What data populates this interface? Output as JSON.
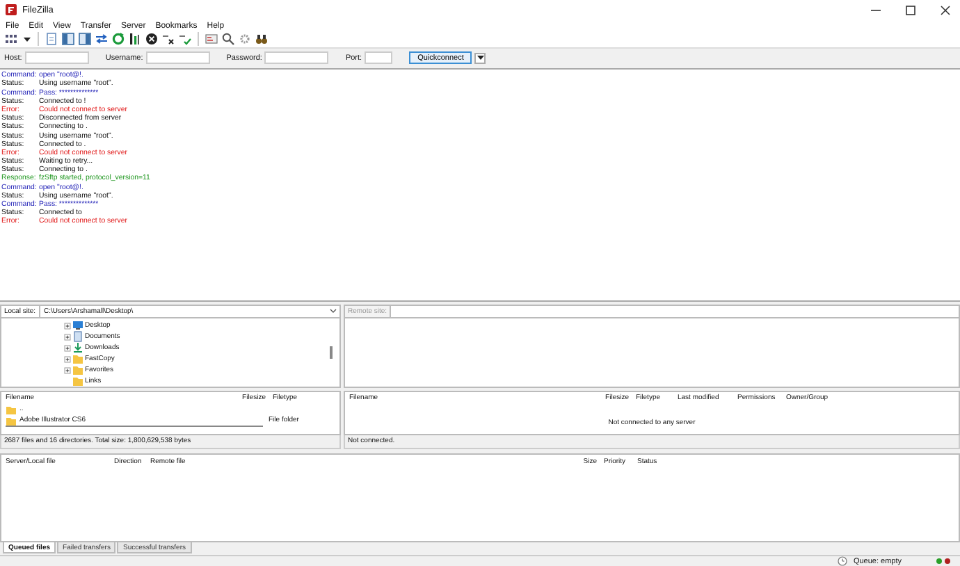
{
  "window": {
    "title": "FileZilla"
  },
  "menu": [
    "File",
    "Edit",
    "View",
    "Transfer",
    "Server",
    "Bookmarks",
    "Help"
  ],
  "quickconnect": {
    "fields": [
      {
        "label": "Host:"
      },
      {
        "label": "Username:"
      },
      {
        "label": "Password:"
      },
      {
        "label": "Port:"
      }
    ],
    "button": "Quickconnect"
  },
  "log": [
    {
      "kind": "command",
      "label": "Command:",
      "message": "open \"root@!."
    },
    {
      "kind": "status",
      "label": "Status:",
      "message": "Using username \"root\"."
    },
    {
      "kind": "command",
      "label": "Command:",
      "message": "Pass: **************"
    },
    {
      "kind": "status",
      "label": "Status:",
      "message": "Connected to !"
    },
    {
      "kind": "error",
      "label": "Error:",
      "message": "Could not connect to server"
    },
    {
      "kind": "status",
      "label": "Status:",
      "message": "Disconnected from server"
    },
    {
      "kind": "status",
      "label": "Status:",
      "message": "Connecting to ."
    },
    {
      "kind": "status",
      "label": "Status:",
      "message": "Using username \"root\"."
    },
    {
      "kind": "status",
      "label": "Status:",
      "message": "Connected to ."
    },
    {
      "kind": "error",
      "label": "Error:",
      "message": "Could not connect to server"
    },
    {
      "kind": "status",
      "label": "Status:",
      "message": "Waiting to retry..."
    },
    {
      "kind": "status",
      "label": "Status:",
      "message": "Connecting to ."
    },
    {
      "kind": "response",
      "label": "Response:",
      "message": "fzSftp started, protocol_version=11"
    },
    {
      "kind": "command",
      "label": "Command:",
      "message": "open \"root@!."
    },
    {
      "kind": "status",
      "label": "Status:",
      "message": "Using username \"root\"."
    },
    {
      "kind": "command",
      "label": "Command:",
      "message": "Pass: **************"
    },
    {
      "kind": "status",
      "label": "Status:",
      "message": "Connected to"
    },
    {
      "kind": "error",
      "label": "Error:",
      "message": "Could not connect to server"
    }
  ],
  "local": {
    "site_label": "Local site:",
    "path": "C:\\Users\\Arshamall\\Desktop\\",
    "tree": [
      {
        "kind": "desktop",
        "name": "Desktop",
        "expandable": true
      },
      {
        "kind": "documents",
        "name": "Documents",
        "expandable": true
      },
      {
        "kind": "downloads",
        "name": "Downloads",
        "expandable": true
      },
      {
        "kind": "folder",
        "name": "FastCopy",
        "expandable": true
      },
      {
        "kind": "folder",
        "name": "Favorites",
        "expandable": true
      },
      {
        "kind": "folder",
        "name": "Links",
        "expandable": false
      }
    ],
    "columns": [
      "Filename",
      "Filesize",
      "Filetype"
    ],
    "rows": [
      {
        "name": "..",
        "type": ""
      },
      {
        "name": "Adobe Illustrator CS6",
        "type": "File folder"
      }
    ],
    "status": "2687 files and 16 directories. Total size: 1,800,629,538 bytes"
  },
  "remote": {
    "site_label": "Remote site:",
    "columns": [
      "Filename",
      "Filesize",
      "Filetype",
      "Last modified",
      "Permissions",
      "Owner/Group"
    ],
    "empty_message": "Not connected to any server",
    "status": "Not connected."
  },
  "queue": {
    "columns": [
      "Server/Local file",
      "Direction",
      "Remote file",
      "Size",
      "Priority",
      "Status"
    ],
    "tabs": [
      {
        "label": "Queued files",
        "selected": true
      },
      {
        "label": "Failed transfers",
        "selected": false
      },
      {
        "label": "Successful transfers",
        "selected": false
      }
    ],
    "status": "Queue: empty"
  }
}
